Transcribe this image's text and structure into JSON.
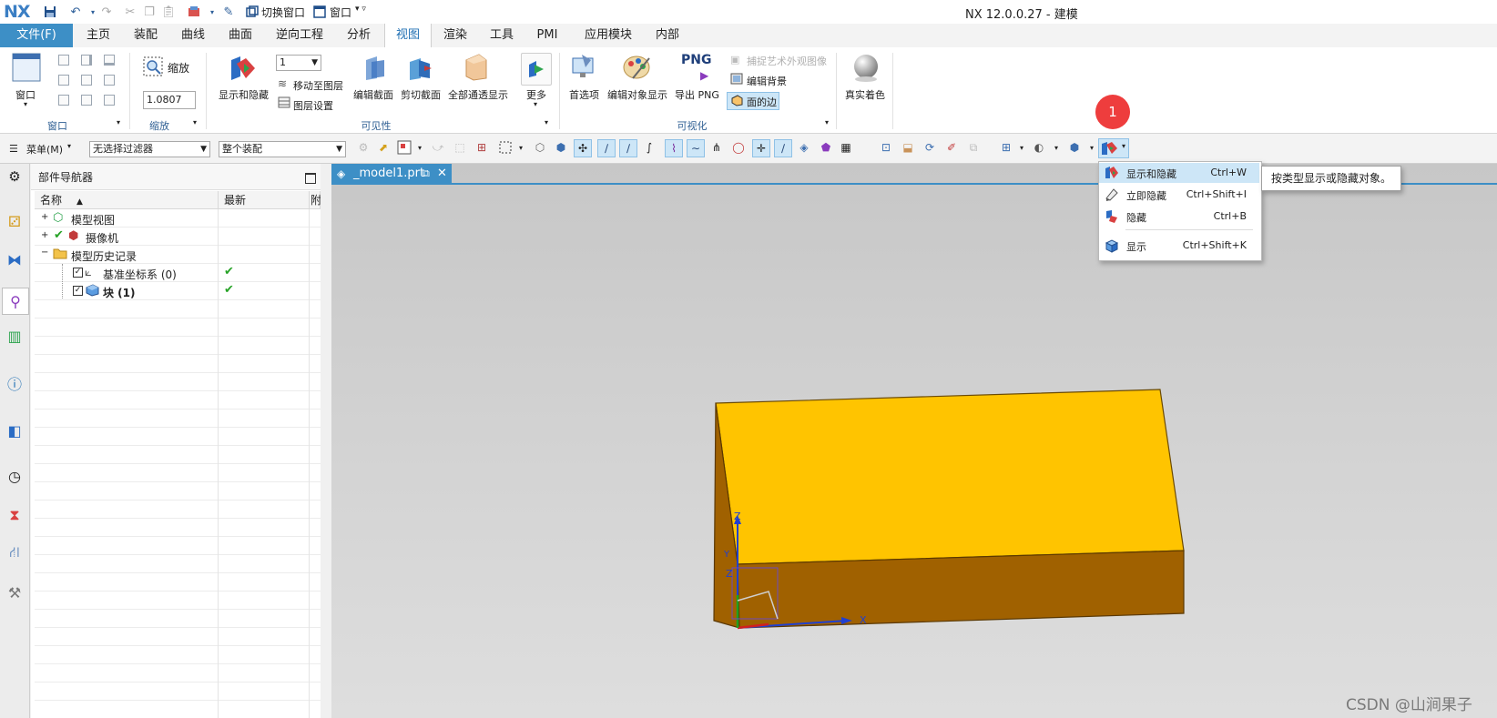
{
  "titlebar": {
    "logo": "NX",
    "switch_window": "切换窗口",
    "window_menu": "窗口",
    "title": "NX 12.0.0.27 - 建模"
  },
  "tabs": [
    {
      "label": "文件(F)"
    },
    {
      "label": "主页"
    },
    {
      "label": "装配"
    },
    {
      "label": "曲线"
    },
    {
      "label": "曲面"
    },
    {
      "label": "逆向工程"
    },
    {
      "label": "分析"
    },
    {
      "label": "视图"
    },
    {
      "label": "渲染"
    },
    {
      "label": "工具"
    },
    {
      "label": "PMI"
    },
    {
      "label": "应用模块"
    },
    {
      "label": "内部"
    }
  ],
  "ribbon": {
    "window": {
      "button": "窗口",
      "group": "窗口"
    },
    "zoom": {
      "button": "缩放",
      "value": "1.0807",
      "group": "缩放"
    },
    "visibility": {
      "show_hide": "显示和隐藏",
      "layer_value": "1",
      "move_to_layer": "移动至图层",
      "layer_settings": "图层设置",
      "edit_section": "编辑截面",
      "clip_section": "剪切截面",
      "all_pass": "全部通透显示",
      "more": "更多",
      "group": "可见性"
    },
    "visualization": {
      "preferences": "首选项",
      "edit_object_display": "编辑对象显示",
      "png_big": "PNG",
      "export_png": "导出 PNG",
      "capture_art": "捕捉艺术外观图像",
      "edit_background": "编辑背景",
      "face_edges": "面的边",
      "group": "可视化"
    },
    "true_shading": "真实着色"
  },
  "toolbar": {
    "menu": "菜单(M)",
    "filter": "无选择过滤器",
    "scope": "整个装配"
  },
  "navigator": {
    "title": "部件导航器",
    "col_name": "名称",
    "col_latest": "最新",
    "col_extra": "附",
    "rows": [
      {
        "label": "模型视图"
      },
      {
        "label": "摄像机"
      },
      {
        "label": "模型历史记录"
      },
      {
        "label": "基准坐标系 (0)"
      },
      {
        "label": "块 (1)"
      }
    ]
  },
  "document_tab": {
    "label": "_model1.prt"
  },
  "dropdown": {
    "items": [
      {
        "label": "显示和隐藏",
        "shortcut": "Ctrl+W"
      },
      {
        "label": "立即隐藏",
        "shortcut": "Ctrl+Shift+I"
      },
      {
        "label": "隐藏",
        "shortcut": "Ctrl+B"
      },
      {
        "label": "显示",
        "shortcut": "Ctrl+Shift+K"
      }
    ]
  },
  "tooltip": "按类型显示或隐藏对象。",
  "badge": "1",
  "axes": {
    "x": "X",
    "y": "Y",
    "z": "Z"
  },
  "watermark": "CSDN @山涧果子",
  "colors": {
    "accent": "#3d8fc6",
    "block_top": "#ffc400",
    "block_side": "#a06100",
    "badge": "#ee3d3d",
    "check_green": "#27a327"
  }
}
